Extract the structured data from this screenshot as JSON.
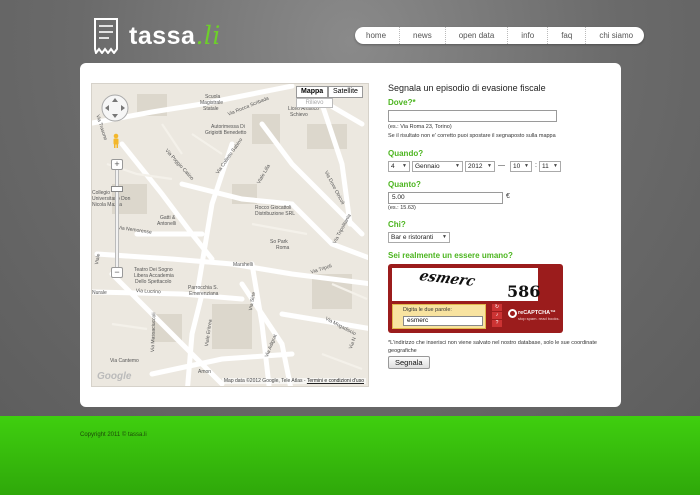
{
  "header": {
    "logo_text": "tassa",
    "logo_tld": ".li"
  },
  "nav": {
    "items": [
      "home",
      "news",
      "open data",
      "info",
      "faq",
      "chi siamo"
    ]
  },
  "map": {
    "type_buttons": [
      "Mappa",
      "Satellite"
    ],
    "active_type": "Mappa",
    "rilievo": "Rilievo",
    "google": "Google",
    "attribution": "Map data ©2012 Google, Tele Atlas -",
    "terms_link": "Termini e condizioni d'uso",
    "labels": {
      "scuola": "Scuola",
      "magistrale": "Magistrale",
      "statale": "Statale",
      "liceo_artistico": "Liceo Artistico",
      "schievo": "Schievo",
      "autorimessa": "Autorimessa Di",
      "grigiotti": "Grigiotti Benedetto",
      "via_rocca_scribada": "Via Rocca Scribada",
      "via_poggio_catino": "Via Poggio Catino",
      "via_collelo_sabino": "Via Colletto Sabino",
      "via_dalla_chiesa": "Viale Lilla",
      "via_otricoli": "Via Dove Otricoli",
      "via_tripolitania": "Via Tripolitania",
      "collegio": "Collegio",
      "universitario": "Universitario Don",
      "nicola_mazza": "Nicola Mazza",
      "gatti": "Gatti &",
      "antonelli": "Antonelli",
      "rocco_giocattoli": "Rocco Giocattoli",
      "distribuzione": "Distribuzione SRL",
      "via_nemorense": "Via Nemorense",
      "so_park": "So Park",
      "roma": "Roma",
      "via_tripoli": "Via Tripoli",
      "marshelli": "Marshelli",
      "teatro": "Teatro Dei Sogno",
      "libera_accademia": "Libera Accademia",
      "dello_spettacolo": "Dello Spettacolo",
      "parrocchia": "Parrocchia S.",
      "emerenziana": "Emerenziana",
      "via_lucrino": "Via Lucrino",
      "nurale": "Nurale",
      "via_massaciuccoli": "Via Massaciuccoli",
      "via_eritrea": "Viale Eritrea",
      "via_sirte": "Via Sirte",
      "via_adigrat": "Via Adigrat",
      "via_mogadiscio": "Via Mogadiscio",
      "via_cantemo": "Via Cantemo",
      "via_trasone": "Via Trasone",
      "via_labeo": "Viale",
      "via_nomentana": "Via N",
      "amon": "Amon"
    }
  },
  "form": {
    "title": "Segnala un episodio di evasione fiscale",
    "dove_label": "Dove?*",
    "dove_value": "",
    "dove_example": "(es.: Via Roma 23, Torino)",
    "dove_hint": "Se il risultato non e' corretto puoi spostare il segnaposto sulla mappa",
    "quando_label": "Quando?",
    "quando": {
      "day": "4",
      "month": "Gennaio",
      "year": "2012",
      "dash": "—",
      "hour": "10",
      "colon": ":",
      "minute": "11"
    },
    "quanto_label": "Quanto?",
    "quanto_value": "5.00",
    "currency": "€",
    "quanto_example": "(es.: 15.63)",
    "chi_label": "Chi?",
    "chi_value": "Bar e ristoranti",
    "human_label": "Sei realmente un essere umano?",
    "captcha": {
      "word1": "esmerc",
      "word2": "586",
      "instruction": "Digita le due parole:",
      "input_value": "esmerc",
      "brand": "reCAPTCHA™",
      "tagline": "stop spam. read books.",
      "btn_refresh": "↻",
      "btn_audio": "♪",
      "btn_help": "?"
    },
    "note": "*L'indirizzo che inserisci non viene salvato nel nostro database, solo le sue coordinate geografiche",
    "submit": "Segnala"
  },
  "footer": {
    "copyright": "Copyright 2011 © tassa.li"
  }
}
